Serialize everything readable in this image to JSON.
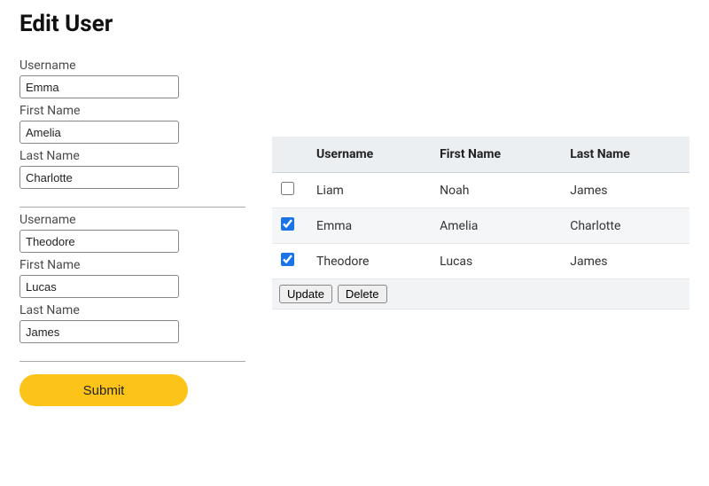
{
  "title": "Edit User",
  "form": {
    "groups": [
      {
        "username": {
          "label": "Username",
          "value": "Emma"
        },
        "firstname": {
          "label": "First Name",
          "value": "Amelia"
        },
        "lastname": {
          "label": "Last Name",
          "value": "Charlotte"
        }
      },
      {
        "username": {
          "label": "Username",
          "value": "Theodore"
        },
        "firstname": {
          "label": "First Name",
          "value": "Lucas"
        },
        "lastname": {
          "label": "Last Name",
          "value": "James"
        }
      }
    ],
    "submit_label": "Submit"
  },
  "table": {
    "headers": {
      "username": "Username",
      "firstname": "First Name",
      "lastname": "Last Name"
    },
    "rows": [
      {
        "checked": false,
        "username": "Liam",
        "firstname": "Noah",
        "lastname": "James"
      },
      {
        "checked": true,
        "username": "Emma",
        "firstname": "Amelia",
        "lastname": "Charlotte"
      },
      {
        "checked": true,
        "username": "Theodore",
        "firstname": "Lucas",
        "lastname": "James"
      }
    ],
    "actions": {
      "update": "Update",
      "delete": "Delete"
    }
  }
}
